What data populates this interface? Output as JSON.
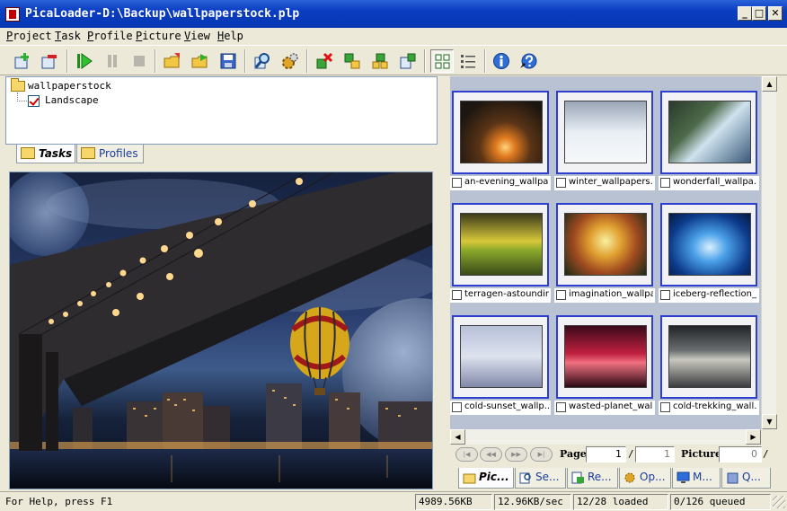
{
  "window": {
    "title": "PicaLoader-D:\\Backup\\wallpaperstock.plp",
    "minimize_label": "_",
    "maximize_label": "□",
    "close_label": "✕"
  },
  "menu": [
    {
      "first": "P",
      "rest": "roject"
    },
    {
      "first": "T",
      "rest": "ask"
    },
    {
      "first": "P",
      "rest": "rofile"
    },
    {
      "first": "P",
      "rest": "icture"
    },
    {
      "first": "V",
      "rest": "iew"
    },
    {
      "first": "H",
      "rest": "elp"
    }
  ],
  "toolbar": {
    "icons": [
      "new-project-icon",
      "remove-project-icon",
      "start-icon",
      "pause-icon",
      "stop-icon",
      "open-folder-icon",
      "export-folder-icon",
      "save-icon",
      "search-icon",
      "settings-icon",
      "delete-task-icon",
      "task-down-icon",
      "task-queue-icon",
      "task-info-icon",
      "thumbnail-view-icon",
      "list-view-icon",
      "info-icon",
      "help-icon"
    ]
  },
  "tree": {
    "root": "wallpaperstock",
    "child": "Landscape"
  },
  "left_tabs": {
    "tasks": "Tasks",
    "profiles": "Profiles"
  },
  "thumbnails": [
    {
      "name": "an-evening_wallpa..."
    },
    {
      "name": "winter_wallpapers..."
    },
    {
      "name": "wonderfall_wallpa..."
    },
    {
      "name": "terragen-astoundin..."
    },
    {
      "name": "imagination_wallpa..."
    },
    {
      "name": "iceberg-reflection_..."
    },
    {
      "name": "cold-sunset_wallp..."
    },
    {
      "name": "wasted-planet_wal..."
    },
    {
      "name": "cold-trekking_wall..."
    }
  ],
  "scroll": {
    "up": "▲",
    "down": "▼",
    "left": "◀",
    "right": "▶"
  },
  "pager": {
    "first": "|◀",
    "prev": "◀◀",
    "next": "▶▶",
    "last": "▶|",
    "page_label": "Page",
    "page_value": "1",
    "slash": "/",
    "page_total": "1",
    "picture_label": "Picture",
    "picture_value": "0"
  },
  "right_tabs": [
    {
      "label": "Pic...",
      "icon": "picture-tab-icon"
    },
    {
      "label": "Se...",
      "icon": "search-tab-icon"
    },
    {
      "label": "Re...",
      "icon": "result-tab-icon"
    },
    {
      "label": "Op...",
      "icon": "options-tab-icon"
    },
    {
      "label": "M...",
      "icon": "monitor-tab-icon"
    },
    {
      "label": "Q...",
      "icon": "queue-tab-icon"
    }
  ],
  "status": {
    "help": "For Help, press F1",
    "size": "4989.56KB",
    "speed": "12.96KB/sec",
    "loaded": "12/28 loaded",
    "queued": "0/126 queued"
  }
}
